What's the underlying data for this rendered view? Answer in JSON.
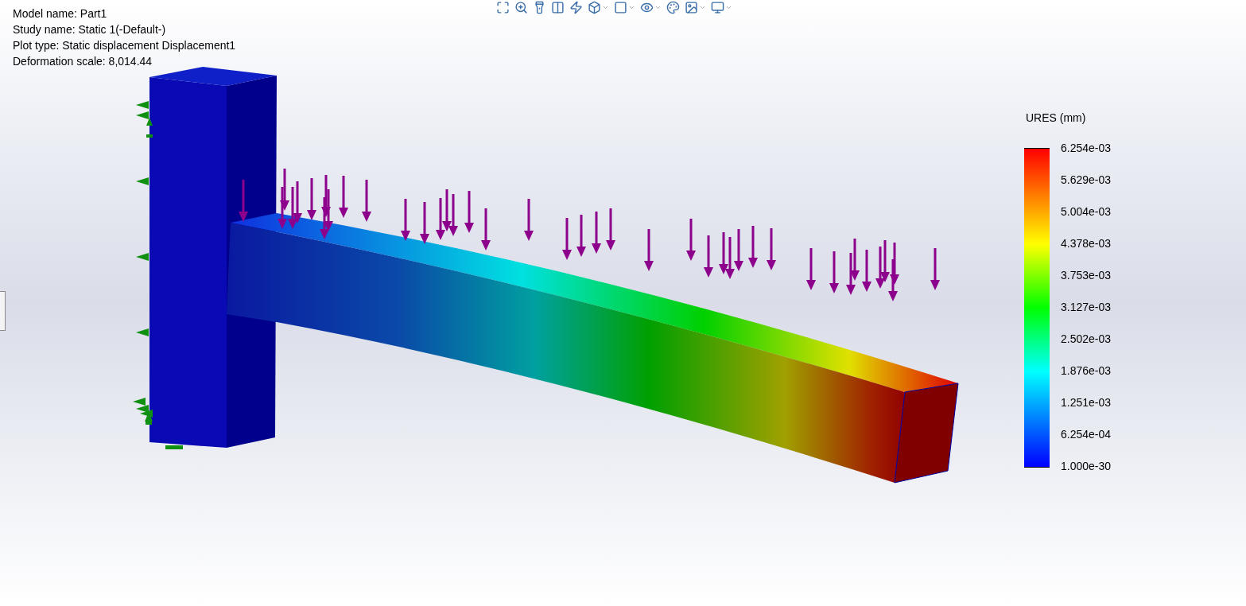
{
  "plot_info": [
    "Model name: Part1",
    "Study name: Static 1(-Default-)",
    "Plot type: Static displacement Displacement1",
    "Deformation scale: 8,014.44"
  ],
  "legend": {
    "title": "URES (mm)",
    "labels": [
      "6.254e-03",
      "5.629e-03",
      "5.004e-03",
      "4.378e-03",
      "3.753e-03",
      "3.127e-03",
      "2.502e-03",
      "1.876e-03",
      "1.251e-03",
      "6.254e-04",
      "1.000e-30"
    ]
  }
}
